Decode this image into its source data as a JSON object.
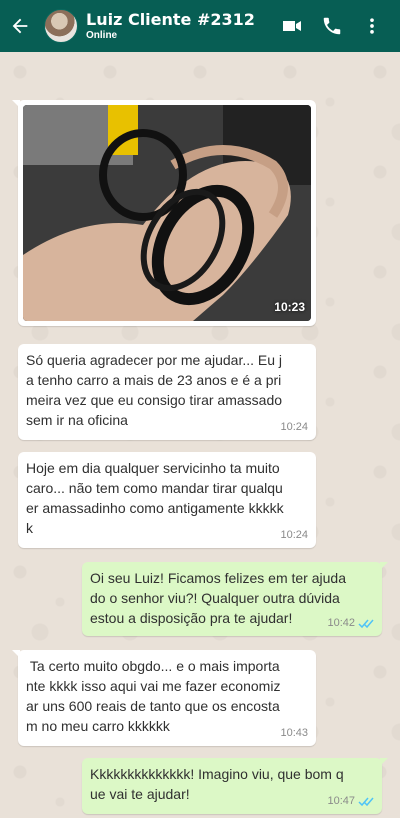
{
  "header": {
    "contact_name": "Luiz Cliente #2312",
    "status": "Online"
  },
  "colors": {
    "header_bg": "#075e54",
    "incoming_bubble": "#ffffff",
    "outgoing_bubble": "#dcf8c6",
    "read_ticks": "#4fc3f7"
  },
  "icons": [
    "back-arrow-icon",
    "avatar",
    "video-camera-icon",
    "phone-icon",
    "more-vert-icon",
    "double-check-icon"
  ],
  "messages": [
    {
      "type": "image",
      "direction": "in",
      "time": "10:23"
    },
    {
      "type": "text",
      "direction": "in",
      "text": "Só queria agradecer por me ajudar... Eu j\na tenho carro a mais de 23 anos e é a pri\nmeira vez que eu consigo tirar amassado\nsem ir na oficina",
      "time": "10:24"
    },
    {
      "type": "text",
      "direction": "in",
      "text": "Hoje em dia qualquer servicinho ta muito\ncaro... não tem como mandar tirar qualqu\ner amassadinho como antigamente kkkkk\nk",
      "time": "10:24"
    },
    {
      "type": "text",
      "direction": "out",
      "text": "Oi seu Luiz! Ficamos felizes em ter ajuda\ndo o senhor viu?! Qualquer outra dúvida\nestou a disposição pra te ajudar!",
      "time": "10:42"
    },
    {
      "type": "text",
      "direction": "in",
      "text": " Ta certo muito obgdo... e o mais importa\nnte kkkk isso aqui vai me fazer economiz\nar uns 600 reais de tanto que os encosta\nm no meu carro kkkkkk",
      "time": "10:43"
    },
    {
      "type": "text",
      "direction": "out",
      "text": "Kkkkkkkkkkkkkk! Imagino viu, que bom q\nue vai te ajudar!",
      "time": "10:47"
    }
  ]
}
